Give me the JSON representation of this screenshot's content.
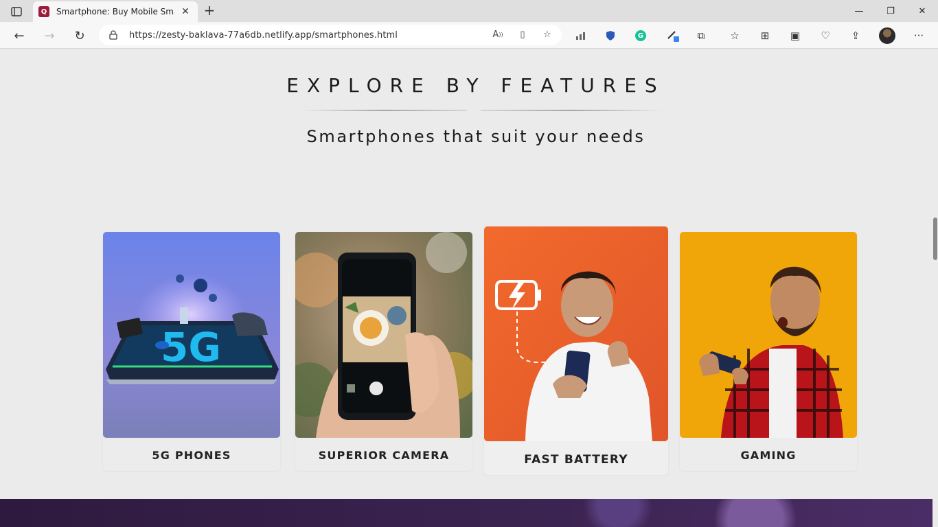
{
  "browser": {
    "tab_title": "Smartphone: Buy Mobile Smartp",
    "url": "https://zesty-baklava-77a6db.netlify.app/smartphones.html",
    "icons": [
      "tab-actions-icon",
      "close-tab-icon",
      "new-tab-icon",
      "minimize-icon",
      "restore-icon",
      "close-window-icon",
      "back-icon",
      "forward-icon",
      "refresh-icon",
      "lock-icon",
      "read-aloud-icon",
      "immersive-reader-icon",
      "add-favorite-icon",
      "extension-chart-icon",
      "shield-extension-icon",
      "grammarly-icon",
      "pen-extension-icon",
      "extensions-icon",
      "favorites-icon",
      "collections-icon",
      "web-capture-icon",
      "browser-essentials-icon",
      "share-icon",
      "profile-avatar",
      "more-icon"
    ]
  },
  "section": {
    "heading": "EXPLORE BY FEATURES",
    "subheading": "Smartphones that suit your needs"
  },
  "features": [
    {
      "label": "5G PHONES"
    },
    {
      "label": "SUPERIOR CAMERA"
    },
    {
      "label": "FAST BATTERY"
    },
    {
      "label": "GAMING"
    }
  ],
  "colors": {
    "accent_tab": "#9c1b38",
    "battery_bg": "#f06a2c",
    "gaming_bg": "#f2a90a",
    "fiveg_bg": "#6f86e8",
    "footer": "#3c2452"
  }
}
